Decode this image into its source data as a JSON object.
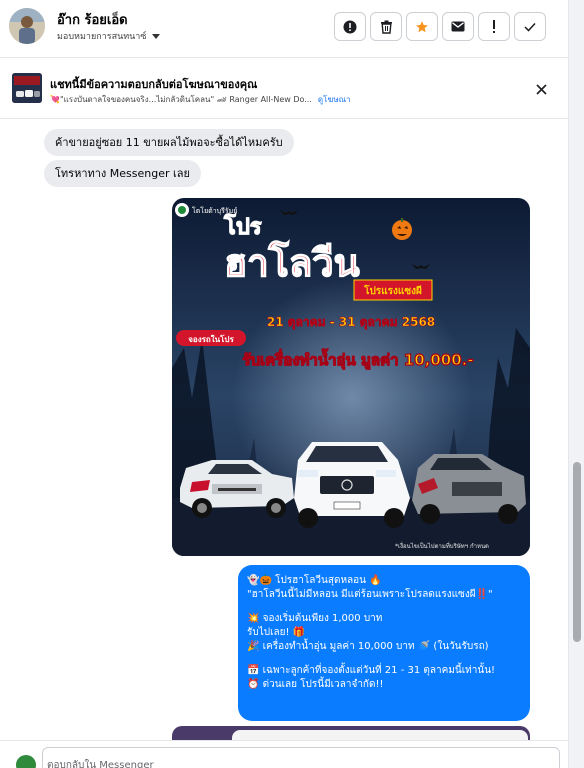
{
  "header": {
    "contact_name": "อ๊าก ร้อยเอ็ด",
    "assign_label": "มอบหมายการสนทนาซ์",
    "actions": [
      "spam-report",
      "delete",
      "star",
      "mark-unread",
      "flag",
      "done"
    ]
  },
  "ad_banner": {
    "title": "แชทนี้มีข้อความตอบกลับต่อโฆษณาของคุณ",
    "ad_text": "💘\"แรงบันดาลใจของคนจริง...ไม่กลัวดินโคลน\" 🏎 Ranger All-New Do...",
    "link_label": "ดูโฆษณา"
  },
  "messages": {
    "incoming": [
      "ค้าขายอยู่ซอย 11 ขายผลไม้พอจะซื้อได้ไหมครับ",
      "โทรหาทาง Messenger เลย"
    ],
    "poster": {
      "brand": "โตโยต้าบุรีรัมย์",
      "headline_1": "โปร",
      "headline_2": "ฮาโลวีน",
      "tagline": "โปรแรงแซงผี",
      "dates": "21 ตุลาคม - 31 ตุลาคม 2568",
      "badge": "จองรถในโปร",
      "offer": "รับเครื่องทำน้ำอุ่น มูลค่า 10,000.-",
      "footnote": "*เงื่อนไขเป็นไปตามที่บริษัทฯ กำหนด"
    },
    "outgoing_lines": [
      "👻🎃 โปรฮาโลวีนสุดหลอน 🔥",
      "\"ฮาโลวีนนี้ไม่มีหลอน มีแต่ร้อนเพราะโปรลดแรงแซงผี‼️\"",
      "",
      "💥 จองเริ่มต้นเพียง 1,000 บาท",
      "รับไปเลย! 🎁",
      "🎉 เครื่องทำน้ำอุ่น มูลค่า 10,000 บาท 🚿 (ในวันรับรถ)",
      "",
      "📅 เฉพาะลูกค้าที่จองตั้งแต่วันที่ 21 - 31 ตุลาคมนี้เท่านั้น!",
      "⏰ ด่วนเลย โปรนี้มีเวลาจำกัด!!"
    ]
  },
  "composer": {
    "placeholder": "ตอบกลับใน Messenger"
  },
  "colors": {
    "accent": "#0a7cff",
    "star": "#f7931e",
    "bubble_in": "#e9ebee",
    "poster_red": "#d2152a",
    "poster_yellow": "#ffd200"
  }
}
